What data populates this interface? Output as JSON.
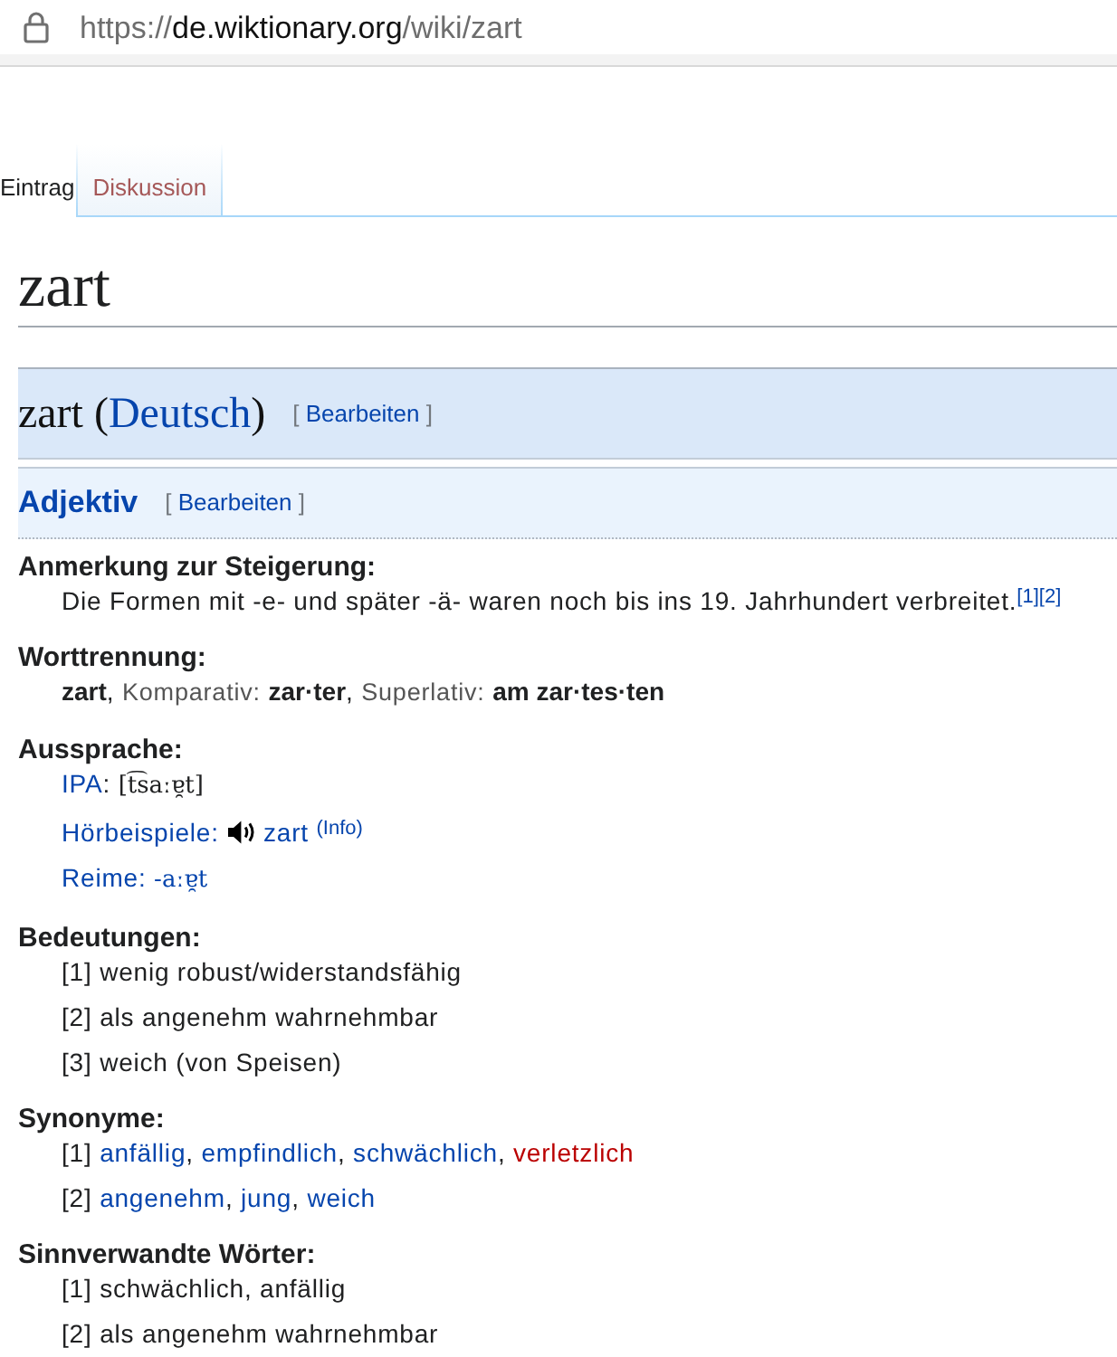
{
  "address_bar": {
    "scheme": "https://",
    "host": "de.wiktionary.org",
    "path": "/wiki/zart"
  },
  "tabs": [
    {
      "label": "Eintrag",
      "selected": true,
      "missing": false
    },
    {
      "label": "Diskussion",
      "selected": false,
      "missing": true
    }
  ],
  "page_title": "zart",
  "language_heading": {
    "before": "zart (",
    "link": "Deutsch",
    "after": ")",
    "edit": {
      "open": "[",
      "label": "Bearbeiten",
      "close": "]"
    }
  },
  "word_class_heading": {
    "label": "Adjektiv",
    "edit": {
      "open": "[",
      "label": "Bearbeiten",
      "close": "]"
    }
  },
  "sections": [
    {
      "heading": "Anmerkung zur Steigerung:",
      "items": [
        {
          "parts": [
            {
              "kind": "text",
              "text": "Die Formen mit -e- und später -ä- waren noch bis ins 19. Jahrhundert verbreitet."
            },
            {
              "kind": "ref",
              "text": "[1]"
            },
            {
              "kind": "ref",
              "text": "[2]"
            }
          ]
        }
      ]
    },
    {
      "heading": "Worttrennung:",
      "items": [
        {
          "parts": [
            {
              "kind": "bold",
              "text": "zart",
              "after": ","
            },
            {
              "kind": "label",
              "text": "Komparativ:"
            },
            {
              "kind": "bold",
              "text": "zar·ter",
              "after": ","
            },
            {
              "kind": "label",
              "text": "Superlativ:"
            },
            {
              "kind": "bold",
              "text": "am zar·tes·ten"
            }
          ]
        }
      ]
    },
    {
      "heading": "Aussprache:",
      "items": [
        {
          "parts": [
            {
              "kind": "link",
              "text": "IPA",
              "after": ":"
            },
            {
              "kind": "ipa",
              "text": "[t͡saːɐ̯t]"
            }
          ]
        },
        {
          "parts": [
            {
              "kind": "link",
              "text": "Hörbeispiele:"
            },
            {
              "kind": "speaker"
            },
            {
              "kind": "link",
              "text": "zart"
            },
            {
              "kind": "info",
              "text": "(Info)"
            }
          ]
        },
        {
          "parts": [
            {
              "kind": "link",
              "text": "Reime:"
            },
            {
              "kind": "ipalink",
              "text": "-aːɐ̯t"
            }
          ]
        }
      ]
    },
    {
      "heading": "Bedeutungen:",
      "items": [
        {
          "num": "[1]",
          "parts": [
            {
              "kind": "text",
              "text": "wenig robust/widerstandsfähig"
            }
          ]
        },
        {
          "num": "[2]",
          "parts": [
            {
              "kind": "text",
              "text": "als angenehm wahrnehmbar"
            }
          ]
        },
        {
          "num": "[3]",
          "parts": [
            {
              "kind": "text",
              "text": "weich (von Speisen)"
            }
          ]
        }
      ]
    },
    {
      "heading": "Synonyme:",
      "items": [
        {
          "num": "[1]",
          "parts": [
            {
              "kind": "link",
              "text": "anfällig",
              "after": ","
            },
            {
              "kind": "link",
              "text": "empfindlich",
              "after": ","
            },
            {
              "kind": "link",
              "text": "schwächlich",
              "after": ","
            },
            {
              "kind": "redlink",
              "text": "verletzlich"
            }
          ]
        },
        {
          "num": "[2]",
          "parts": [
            {
              "kind": "link",
              "text": "angenehm",
              "after": ","
            },
            {
              "kind": "link",
              "text": "jung",
              "after": ","
            },
            {
              "kind": "link",
              "text": "weich"
            }
          ]
        }
      ]
    },
    {
      "heading": "Sinnverwandte Wörter:",
      "items": [
        {
          "num": "[1]",
          "parts": [
            {
              "kind": "text",
              "text": "schwächlich, anfällig"
            }
          ]
        },
        {
          "num": "[2]",
          "parts": [
            {
              "kind": "text",
              "text": "als angenehm wahrnehmbar"
            }
          ]
        }
      ]
    }
  ]
}
